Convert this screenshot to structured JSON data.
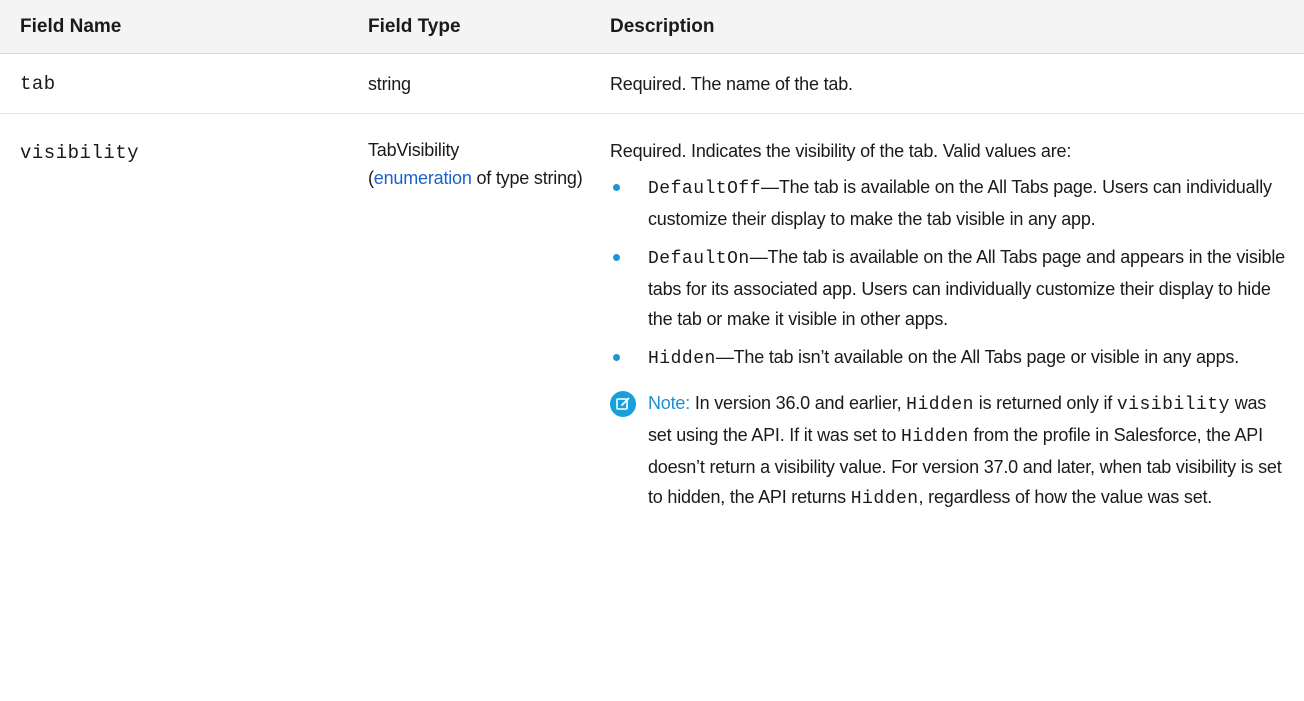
{
  "table": {
    "headers": {
      "field_name": "Field Name",
      "field_type": "Field Type",
      "description": "Description"
    },
    "rows": [
      {
        "name": "tab",
        "type": "string",
        "description": "Required. The name of the tab."
      },
      {
        "name": "visibility",
        "type_prefix": "TabVisibility",
        "type_paren_open": "(",
        "type_link": "enumeration",
        "type_suffix": " of type string)",
        "description_intro": "Required. Indicates the visibility of the tab. Valid values are:",
        "values": [
          {
            "code": "DefaultOff",
            "text": "—The tab is available on the All Tabs page. Users can individually customize their display to make the tab visible in any app."
          },
          {
            "code": "DefaultOn",
            "text": "—The tab is available on the All Tabs page and appears in the visible tabs for its associated app. Users can individually customize their display to hide the tab or make it visible in other apps."
          },
          {
            "code": "Hidden",
            "text": "—The tab isn’t available on the All Tabs page or visible in any apps."
          }
        ],
        "note": {
          "label": "Note:",
          "part1": " In version 36.0 and earlier, ",
          "code1": "Hidden",
          "part2": " is returned only if ",
          "code2": "visibility",
          "part3": " was set using the API. If it was set to ",
          "code3": "Hidden",
          "part4": " from the profile in Salesforce, the API doesn’t return a visibility value. For version 37.0 and later, when tab visibility is set to hidden, the API returns ",
          "code4": "Hidden",
          "part5": ", regardless of how the value was set."
        }
      }
    ]
  },
  "colors": {
    "link": "#1a62c9",
    "accent": "#1b96d8",
    "header_bg": "#f4f4f4"
  },
  "icons": {
    "note": "edit-note-icon",
    "bullet": "bullet-dot"
  }
}
